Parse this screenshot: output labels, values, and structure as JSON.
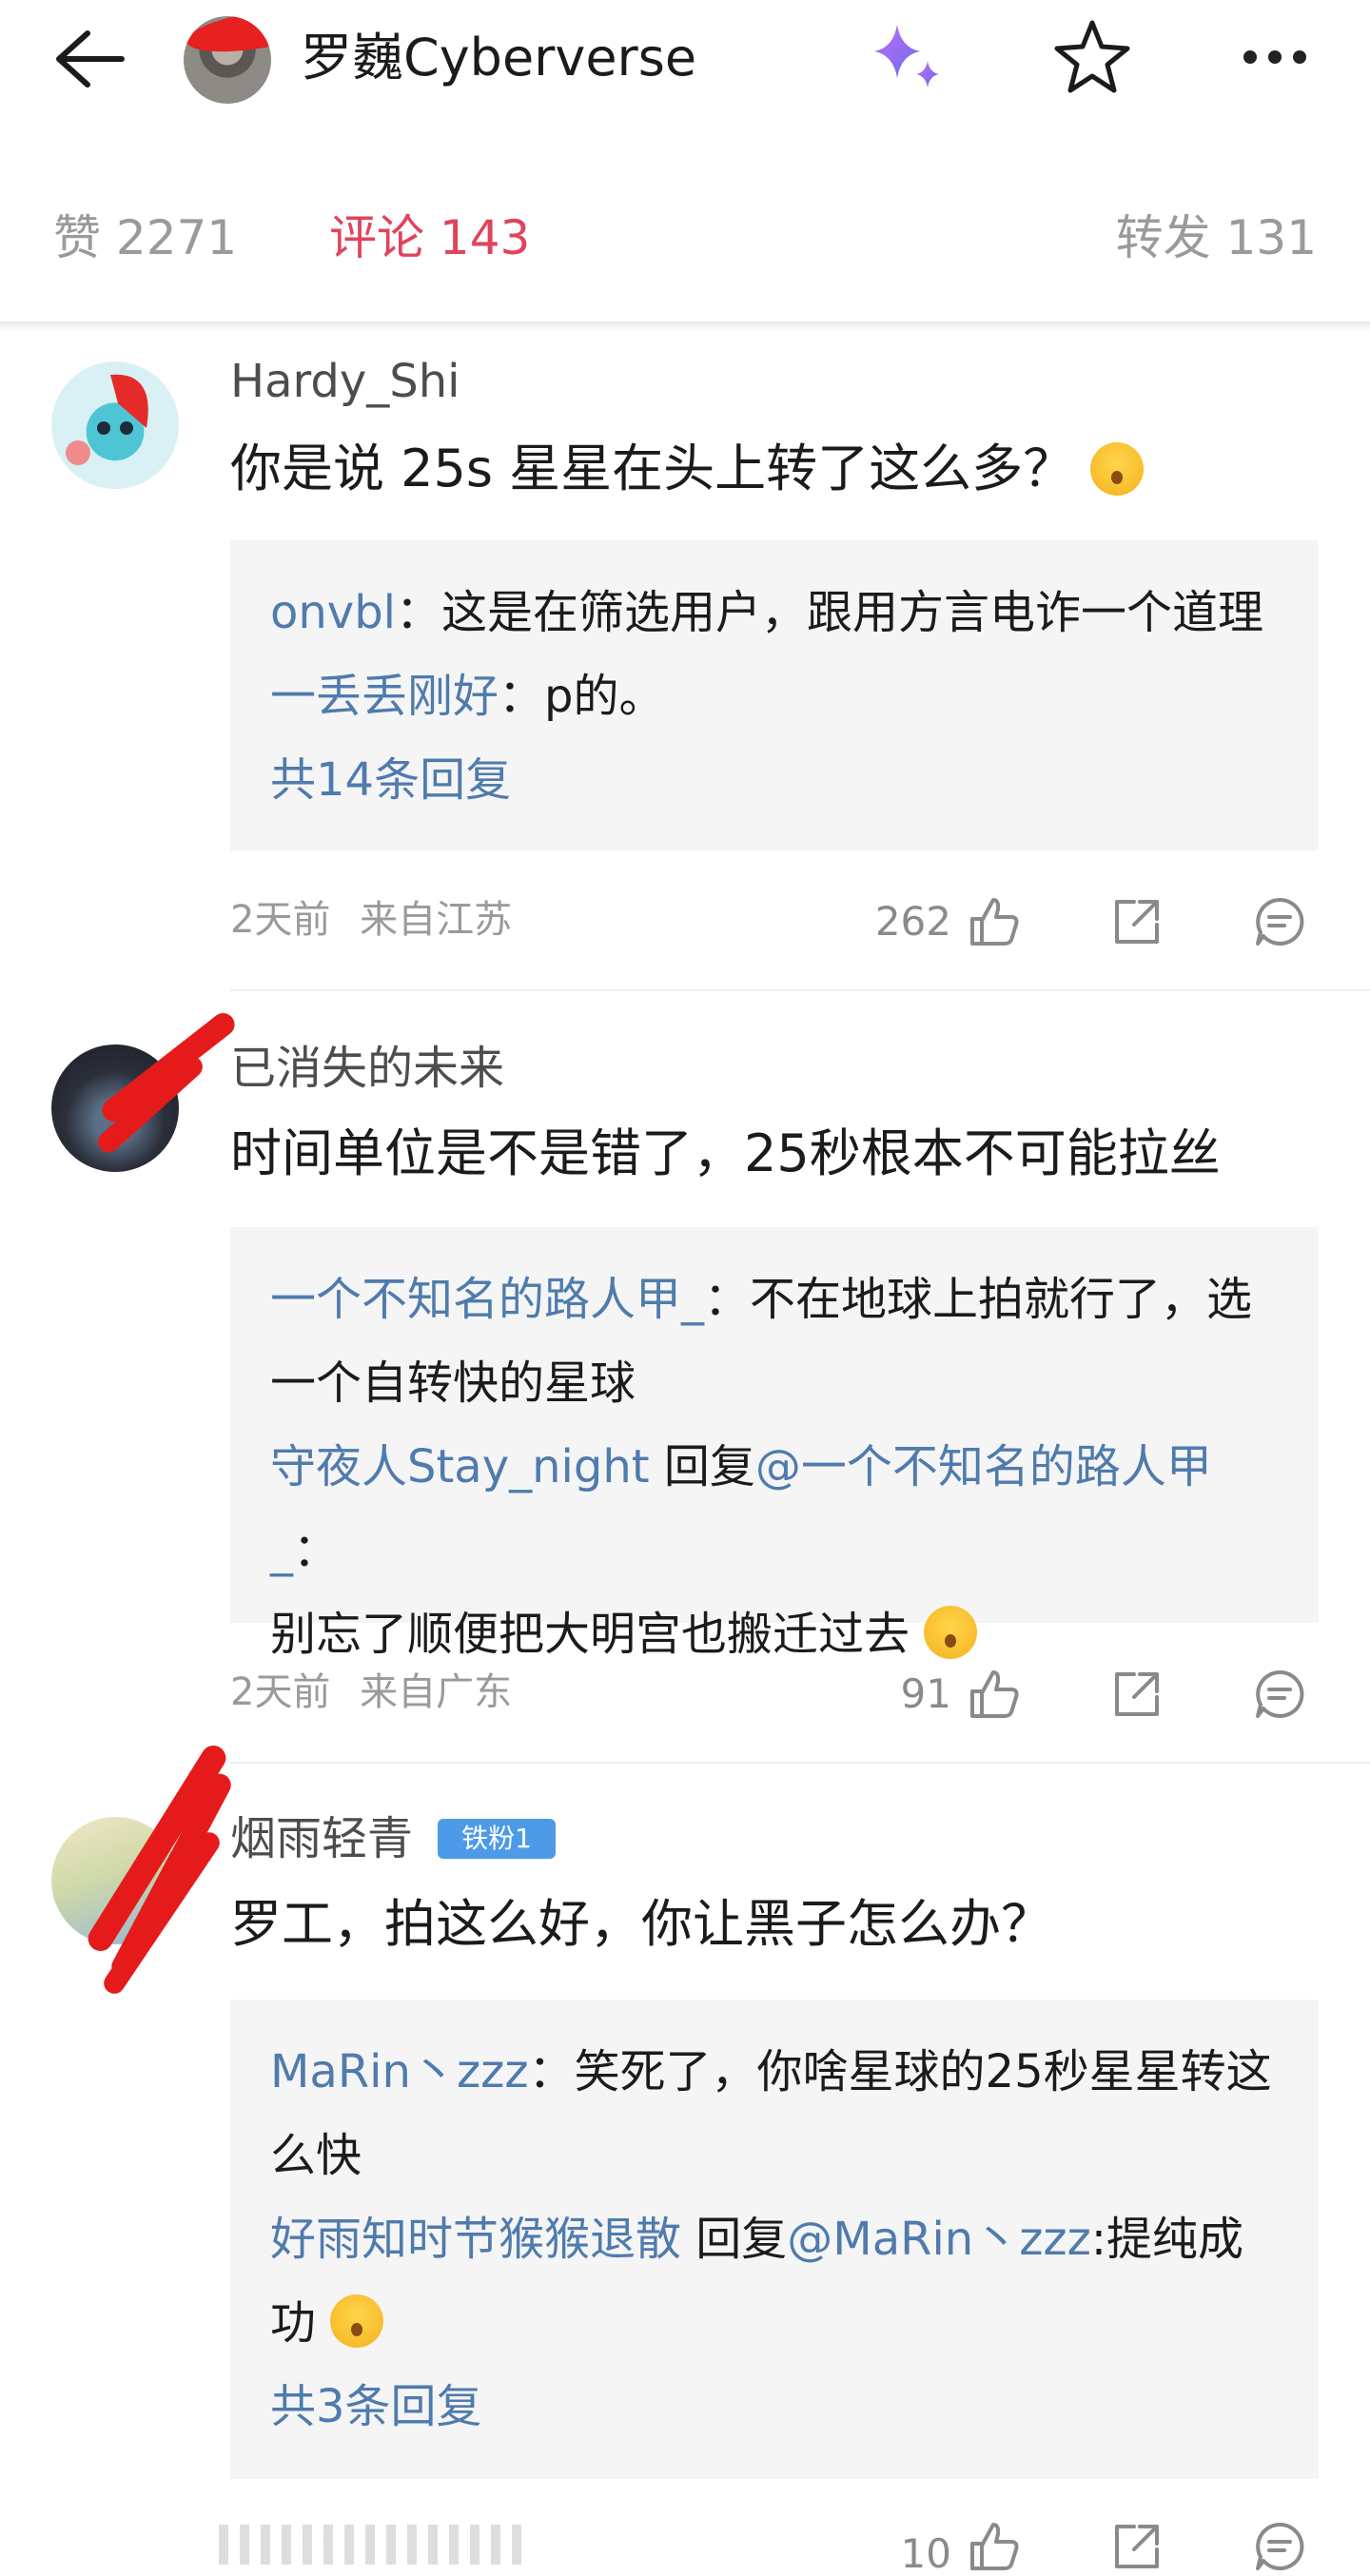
{
  "header": {
    "title": "罗巍Cyberverse",
    "back_icon": "arrow-left-icon",
    "ai_icon": "sparkle-icon",
    "favorite_icon": "star-icon",
    "more_icon": "more-icon"
  },
  "tabs": [
    {
      "label": "赞 2271",
      "active": false
    },
    {
      "label": "评论 143",
      "active": true
    },
    {
      "label": "转发 131",
      "active": false
    }
  ],
  "colors": {
    "accent": "#e0445c",
    "link": "#4f7bad",
    "reply_bg": "#f5f5f5",
    "badge": "#4d9be8"
  },
  "comments": [
    {
      "user": "Hardy_Shi",
      "text": "你是说 25s 星星在头上转了这么多？",
      "replies": [
        {
          "user": "onvbl",
          "sep": "：",
          "text": "这是在筛选用户，跟用方言电诈一个道理"
        },
        {
          "user": "一丢丢刚好",
          "sep": "：",
          "text": "p的。"
        }
      ],
      "more_replies": "共14条回复",
      "time": "2天前",
      "location": "来自江苏",
      "likes": "262"
    },
    {
      "user": "已消失的未来",
      "text": "时间单位是不是错了，25秒根本不可能拉丝",
      "replies": [
        {
          "user": "一个不知名的路人甲_",
          "sep": "：",
          "text_line1": "不在地球上拍就行了，选",
          "text_line2": "一个自转快的星球"
        },
        {
          "user": "守夜人Stay_night",
          "reply_word": " 回复",
          "mention": "@一个不知名的路人甲_",
          "sep": "：",
          "text": "别忘了顺便把大明宫也搬迁过去"
        }
      ],
      "time": "2天前",
      "location": "来自广东",
      "likes": "91"
    },
    {
      "user": "烟雨轻青",
      "badge": "铁粉1",
      "text": "罗工，拍这么好，你让黑子怎么办？",
      "replies": [
        {
          "user": "MaRin丶zzz",
          "sep": "：",
          "text_line1": "笑死了，你啥星球的25秒星星转这",
          "text_line2": "么快"
        },
        {
          "user": "好雨知时节猴猴退散",
          "reply_word": " 回复",
          "mention": "@MaRin丶zzz",
          "sep": ":",
          "text_line1": "提纯成",
          "text_line2": "功"
        }
      ],
      "more_replies": "共3条回复",
      "likes": "10"
    }
  ]
}
